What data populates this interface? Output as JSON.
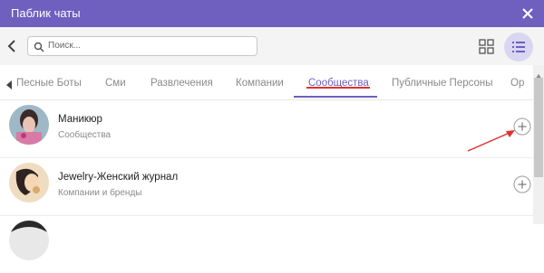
{
  "window": {
    "title": "Паблик чаты"
  },
  "toolbar": {
    "search_placeholder": "Поиск..."
  },
  "tabs": [
    {
      "label": "Песные Боты",
      "active": false
    },
    {
      "label": "Сми",
      "active": false
    },
    {
      "label": "Развлечения",
      "active": false
    },
    {
      "label": "Компании",
      "active": false
    },
    {
      "label": "Сообщества",
      "active": true
    },
    {
      "label": "Публичные Персоны",
      "active": false
    },
    {
      "label": "Ор",
      "active": false
    }
  ],
  "items": [
    {
      "name": "Маникюр",
      "category": "Сообщества"
    },
    {
      "name": "Jewelry-Женский журнал",
      "category": "Компании и бренды"
    },
    {
      "name": "",
      "category": ""
    }
  ],
  "colors": {
    "accent": "#6f5fbf",
    "annotation": "#e03030"
  },
  "icons": {
    "close": "close-icon",
    "back": "chevron-left-icon",
    "search": "search-icon",
    "grid": "grid-view-icon",
    "list": "list-view-icon",
    "add": "plus-circle-icon"
  }
}
